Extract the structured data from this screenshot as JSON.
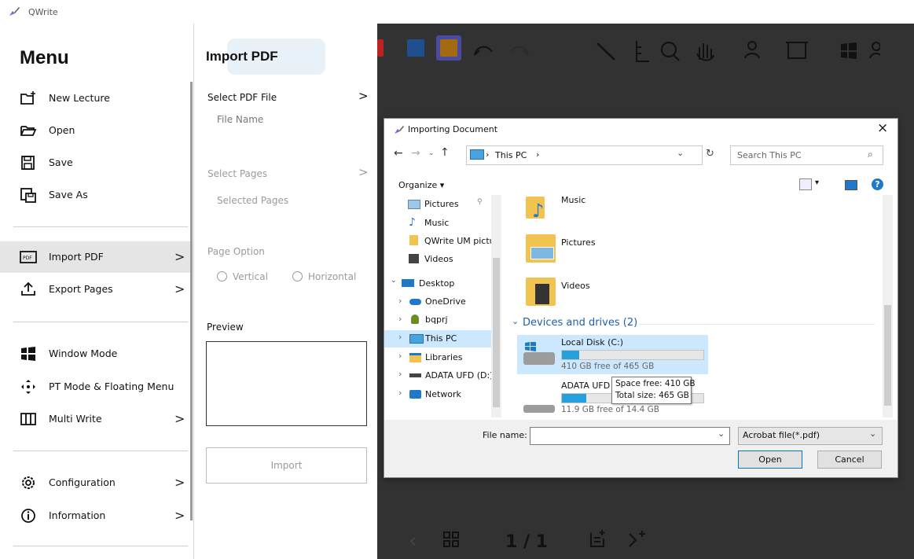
{
  "app": {
    "title": "QWrite"
  },
  "menu": {
    "title": "Menu",
    "items": [
      {
        "label": "New Lecture",
        "icon": "new-lecture-icon"
      },
      {
        "label": "Open",
        "icon": "folder-open-icon"
      },
      {
        "label": "Save",
        "icon": "save-icon"
      },
      {
        "label": "Save As",
        "icon": "save-as-icon"
      },
      {
        "label": "Import PDF",
        "icon": "pdf-icon",
        "chevron": ">"
      },
      {
        "label": "Export Pages",
        "icon": "export-icon",
        "chevron": ">"
      },
      {
        "label": "Window Mode",
        "icon": "windows-icon"
      },
      {
        "label": "PT Mode & Floating Menu",
        "icon": "pt-mode-icon"
      },
      {
        "label": "Multi Write",
        "icon": "multi-write-icon",
        "chevron": ">"
      },
      {
        "label": "Configuration",
        "icon": "gear-icon",
        "chevron": ">"
      },
      {
        "label": "Information",
        "icon": "info-icon",
        "chevron": ">"
      }
    ]
  },
  "import_pane": {
    "title": "Import PDF",
    "select_pdf_label": "Select PDF File",
    "chevron": ">",
    "file_name_label": "File Name",
    "select_pages_label": "Select Pages",
    "selected_pages_label": "Selected Pages",
    "page_option_label": "Page Option",
    "vertical_label": "Vertical",
    "horizontal_label": "Horizontal",
    "preview_label": "Preview",
    "import_button": "Import"
  },
  "bottom_bar": {
    "page_indicator": "1 / 1"
  },
  "dialog": {
    "title": "Importing Document",
    "close": "×",
    "address_path": "This PC",
    "search_placeholder": "Search This PC",
    "organize_label": "Organize ▾",
    "tree": [
      "Pictures",
      "Music",
      "QWrite UM pictu",
      "Videos",
      "Desktop",
      "OneDrive",
      "bqprj",
      "This PC",
      "Libraries",
      "ADATA UFD (D:)",
      "Network"
    ],
    "folders": [
      "Music",
      "Pictures",
      "Videos"
    ],
    "devices_header": "Devices and drives (2)",
    "drives": [
      {
        "name": "Local Disk (C:)",
        "free_text": "410 GB free of 465 GB",
        "used_fraction": 0.12
      },
      {
        "name": "ADATA UFD",
        "free_text": "11.9 GB free of 14.4 GB",
        "used_fraction": 0.17
      }
    ],
    "tooltip_line1": "Space free: 410 GB",
    "tooltip_line2": "Total size: 465 GB",
    "file_name_label": "File name:",
    "file_name_value": "",
    "file_type": "Acrobat file(*.pdf)",
    "open_button": "Open",
    "cancel_button": "Cancel"
  },
  "colors": {
    "canvas": "#323232",
    "accent": "#26a0da",
    "selected_tree": "#cce8ff"
  }
}
